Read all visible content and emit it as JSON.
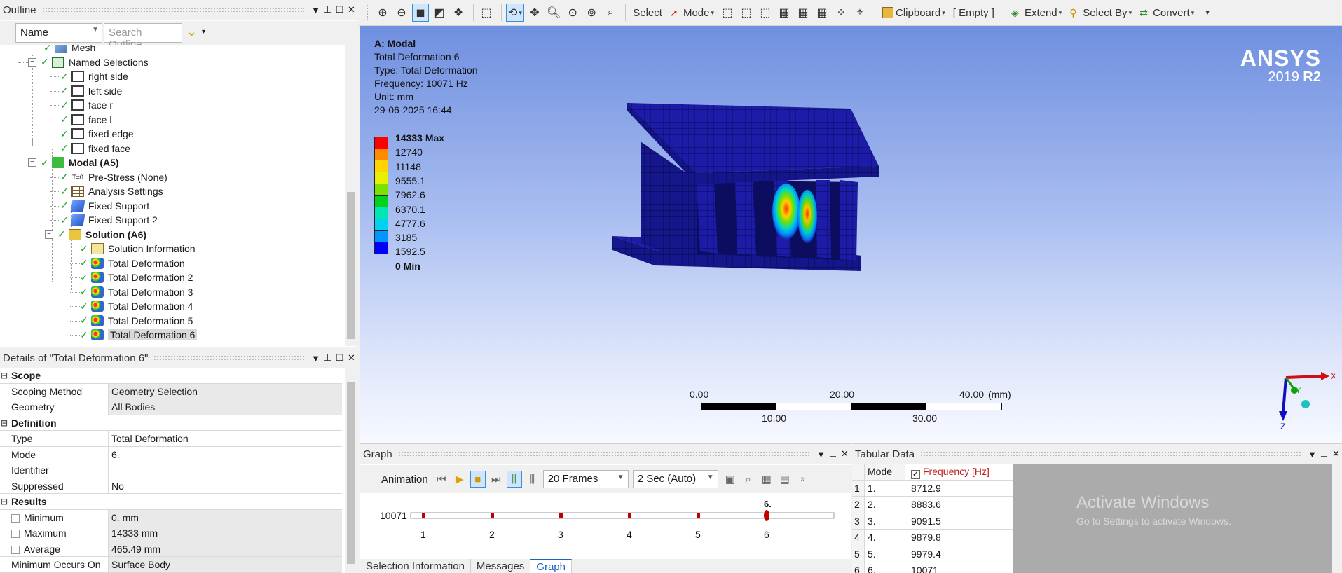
{
  "outline": {
    "title": "Outline",
    "filter_value": "Name",
    "search_placeholder": "Search Outline",
    "tree": [
      {
        "label": "Mesh",
        "icon": "mesh-icon",
        "depth": 1
      },
      {
        "label": "Named Selections",
        "icon": "named-selections-icon",
        "depth": 1
      },
      {
        "label": "right side",
        "icon": "face-selection-icon",
        "depth": 2
      },
      {
        "label": "left side",
        "icon": "face-selection-icon",
        "depth": 2
      },
      {
        "label": "face r",
        "icon": "face-selection-icon",
        "depth": 2
      },
      {
        "label": "face l",
        "icon": "face-selection-icon",
        "depth": 2
      },
      {
        "label": "fixed edge",
        "icon": "edge-selection-icon",
        "depth": 2
      },
      {
        "label": "fixed face",
        "icon": "face-selection-icon",
        "depth": 2
      },
      {
        "label": "Modal (A5)",
        "icon": "modal-analysis-icon",
        "depth": 1
      },
      {
        "label": "Pre-Stress (None)",
        "icon": "prestress-icon",
        "depth": 2
      },
      {
        "label": "Analysis Settings",
        "icon": "analysis-settings-icon",
        "depth": 2
      },
      {
        "label": "Fixed Support",
        "icon": "fixed-support-icon",
        "depth": 2
      },
      {
        "label": "Fixed Support 2",
        "icon": "fixed-support-icon",
        "depth": 2
      },
      {
        "label": "Solution (A6)",
        "icon": "solution-icon",
        "depth": 2
      },
      {
        "label": "Solution Information",
        "icon": "solution-information-icon",
        "depth": 3
      },
      {
        "label": "Total Deformation",
        "icon": "total-deformation-icon",
        "depth": 3
      },
      {
        "label": "Total Deformation 2",
        "icon": "total-deformation-icon",
        "depth": 3
      },
      {
        "label": "Total Deformation 3",
        "icon": "total-deformation-icon",
        "depth": 3
      },
      {
        "label": "Total Deformation 4",
        "icon": "total-deformation-icon",
        "depth": 3
      },
      {
        "label": "Total Deformation 5",
        "icon": "total-deformation-icon",
        "depth": 3
      },
      {
        "label": "Total Deformation 6",
        "icon": "total-deformation-icon",
        "depth": 3
      }
    ]
  },
  "details": {
    "title": "Details of \"Total Deformation 6\"",
    "rows": [
      {
        "type": "group",
        "label": "Scope"
      },
      {
        "type": "prop",
        "key": "Scoping Method",
        "value": "Geometry Selection",
        "readonly": true
      },
      {
        "type": "prop",
        "key": "Geometry",
        "value": "All Bodies",
        "readonly": true
      },
      {
        "type": "group",
        "label": "Definition"
      },
      {
        "type": "prop",
        "key": "Type",
        "value": "Total Deformation",
        "readonly": false
      },
      {
        "type": "prop",
        "key": "Mode",
        "value": "6.",
        "readonly": false
      },
      {
        "type": "prop",
        "key": "Identifier",
        "value": "",
        "readonly": false
      },
      {
        "type": "prop",
        "key": "Suppressed",
        "value": "No",
        "readonly": false
      },
      {
        "type": "group",
        "label": "Results"
      },
      {
        "type": "prop",
        "key": "Minimum",
        "value": "0. mm",
        "readonly": true,
        "checkbox": true
      },
      {
        "type": "prop",
        "key": "Maximum",
        "value": "14333 mm",
        "readonly": true,
        "checkbox": true
      },
      {
        "type": "prop",
        "key": "Average",
        "value": "465.49 mm",
        "readonly": true,
        "checkbox": true
      },
      {
        "type": "prop",
        "key": "Minimum Occurs On",
        "value": "Surface Body",
        "readonly": true
      }
    ]
  },
  "toolbar": {
    "select_label": "Select",
    "mode_label": "Mode",
    "clipboard_label": "Clipboard",
    "empty_label": "[ Empty ]",
    "extend_label": "Extend",
    "select_by_label": "Select By",
    "convert_label": "Convert"
  },
  "viewport": {
    "info": {
      "heading": "A: Modal",
      "lines": [
        "Total Deformation 6",
        "Type: Total Deformation",
        "Frequency: 10071 Hz",
        "Unit: mm",
        "29-06-2025 16:44"
      ]
    },
    "legend": [
      {
        "label": "14333 Max",
        "color": "#ff0000",
        "bold": true
      },
      {
        "label": "12740",
        "color": "#ff8c00"
      },
      {
        "label": "11148",
        "color": "#ffd200"
      },
      {
        "label": "9555.1",
        "color": "#e6f000"
      },
      {
        "label": "7962.6",
        "color": "#7ce000"
      },
      {
        "label": "6370.1",
        "color": "#00d21e"
      },
      {
        "label": "4777.6",
        "color": "#00e6b4"
      },
      {
        "label": "3185",
        "color": "#00d2f0"
      },
      {
        "label": "1592.5",
        "color": "#0096ff"
      },
      {
        "label": "0 Min",
        "color": "#0000ff",
        "bold": true
      }
    ],
    "logo_brand": "ANSYS",
    "logo_version": "2019",
    "logo_release": "R2",
    "scale": {
      "top_labels": [
        "0.00",
        "20.00",
        "40.00"
      ],
      "bottom_labels": [
        "10.00",
        "30.00"
      ],
      "unit": "(mm)"
    },
    "triad": {
      "x": "X",
      "y": "Y",
      "z": "Z"
    },
    "watermark_title": "Activate Windows",
    "watermark_sub": "Go to Settings to activate Windows."
  },
  "graph": {
    "title": "Graph",
    "animation_label": "Animation",
    "frames_value": "20 Frames",
    "duration_value": "2 Sec (Auto)",
    "y_value": "10071",
    "marker_label": "6.",
    "x_ticks": [
      "1",
      "2",
      "3",
      "4",
      "5",
      "6"
    ],
    "tabs": [
      {
        "label": "Selection Information",
        "active": false
      },
      {
        "label": "Messages",
        "active": false
      },
      {
        "label": "Graph",
        "active": true
      }
    ]
  },
  "tabular": {
    "title": "Tabular Data",
    "col_mode": "Mode",
    "col_freq": "Frequency [Hz]",
    "rows": [
      {
        "n": "1",
        "mode": "1.",
        "freq": "8712.9"
      },
      {
        "n": "2",
        "mode": "2.",
        "freq": "8883.6"
      },
      {
        "n": "3",
        "mode": "3.",
        "freq": "9091.5"
      },
      {
        "n": "4",
        "mode": "4.",
        "freq": "9879.8"
      },
      {
        "n": "5",
        "mode": "5.",
        "freq": "9979.4"
      },
      {
        "n": "6",
        "mode": "6.",
        "freq": "10071"
      }
    ]
  }
}
